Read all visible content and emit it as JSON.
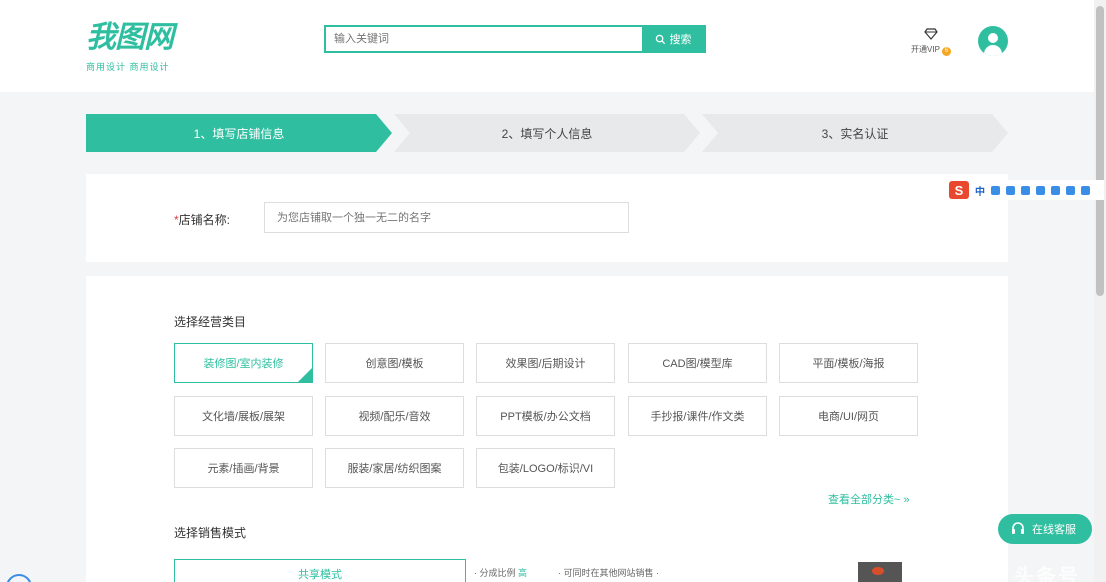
{
  "header": {
    "logo_text": "我图网",
    "logo_sub": "商用设计  商用设计",
    "search": {
      "placeholder": "输入关键词",
      "button_label": "搜索"
    },
    "vip": {
      "label": "开通VIP",
      "badge": "6"
    }
  },
  "steps": [
    {
      "label": "1、填写店铺信息",
      "active": true
    },
    {
      "label": "2、填写个人信息",
      "active": false
    },
    {
      "label": "3、实名认证",
      "active": false
    }
  ],
  "shop": {
    "label": "店铺名称:",
    "required_mark": "*",
    "placeholder": "为您店铺取一个独一无二的名字"
  },
  "ime": {
    "logo": "S",
    "lang": "中"
  },
  "category": {
    "title": "选择经营类目",
    "items": [
      "装修图/室内装修",
      "创意图/模板",
      "效果图/后期设计",
      "CAD图/模型库",
      "平面/模板/海报",
      "文化墙/展板/展架",
      "视频/配乐/音效",
      "PPT模板/办公文档",
      "手抄报/课件/作文类",
      "电商/UI/网页",
      "元素/插画/背景",
      "服装/家居/纺织图案",
      "包装/LOGO/标识/VI"
    ],
    "active_index": 0,
    "more_link": "查看全部分类~ »"
  },
  "sale": {
    "title": "选择销售模式",
    "button_label": "共享模式",
    "note1": "· 分成比例",
    "note1_hl": "高",
    "note2": "· 可同时在其他网站销售 ·"
  },
  "service": {
    "label": "在线客服"
  },
  "watermark": "头条号",
  "colors": {
    "accent": "#2fbfa0",
    "required": "#e4393c",
    "vip_badge": "#f5a623"
  }
}
